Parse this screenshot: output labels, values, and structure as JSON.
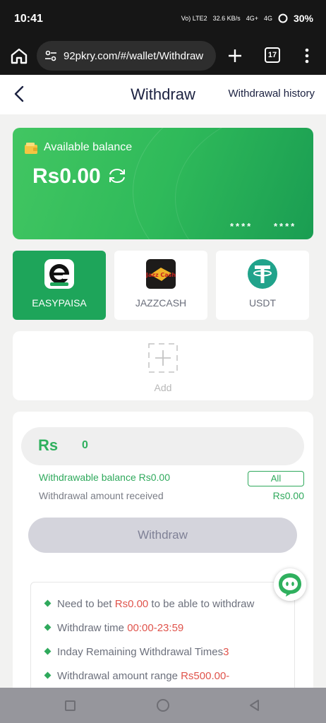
{
  "status_bar": {
    "time": "10:41",
    "network": "Vo) LTE2",
    "speed": "32.6 KB/s",
    "signal1": "4G+",
    "signal2": "4G",
    "battery": "30%"
  },
  "browser": {
    "url": "92pkry.com/#/wallet/Withdraw",
    "tab_count": "17"
  },
  "header": {
    "title": "Withdraw",
    "history_label": "Withdrawal history"
  },
  "balance_card": {
    "label": "Available balance",
    "amount": "Rs0.00",
    "mask_left": "****",
    "mask_right": "****"
  },
  "methods": [
    {
      "label": "EASYPAISA",
      "active": true
    },
    {
      "label": "JAZZCASH",
      "active": false,
      "logo_text": "Jazz Cash"
    },
    {
      "label": "USDT",
      "active": false
    }
  ],
  "add_card": {
    "label": "Add"
  },
  "withdraw_form": {
    "currency": "Rs",
    "amount_value": "0",
    "withdrawable_label": "Withdrawable balance Rs0.00",
    "all_label": "All",
    "received_label": "Withdrawal amount received",
    "received_value": "Rs0.00",
    "submit_label": "Withdraw"
  },
  "rules": {
    "r1_prefix": "Need to bet ",
    "r1_value": "Rs0.00",
    "r1_suffix": " to be able to withdraw",
    "r2_prefix": "Withdraw time ",
    "r2_value": "00:00-23:59",
    "r3_prefix": "Inday Remaining Withdrawal Times",
    "r3_value": "3",
    "r4_prefix": "Withdrawal amount range ",
    "r4_value": "Rs500.00-"
  },
  "colors": {
    "accent_green": "#2fa95c",
    "card_green": "#2fba5a",
    "highlight_red": "#e0544c",
    "title_navy": "#1b2140"
  }
}
